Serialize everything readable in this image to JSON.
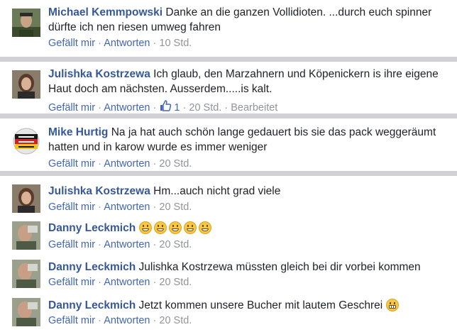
{
  "comments": [
    {
      "author": "Michael Kemmpowski",
      "text": "Danke an die ganzen Vollidioten. ...durch euch spinner dürfte ich nen riesen umweg fahren",
      "like": "Gefällt mir",
      "reply": "Antworten",
      "time": "10 Std."
    },
    {
      "author": "Julishka Kostrzewa",
      "text": "Ich glaub, den Marzahnern und Köpenickern is ihre eigene Haut doch am nächsten. Ausserdem.....is kalt.",
      "like": "Gefällt mir",
      "reply": "Antworten",
      "likes_count": "1",
      "time": "20 Std.",
      "edited": "Bearbeitet"
    },
    {
      "author": "Mike Hurtig",
      "text": "Na ja hat auch schön lange gedauert bis sie das pack weggeräumt hatten und in karow wurde es immer weniger",
      "like": "Gefällt mir",
      "reply": "Antworten",
      "time": "20 Std."
    },
    {
      "author": "Julishka Kostrzewa",
      "text": "Hm...auch nicht grad viele",
      "like": "Gefällt mir",
      "reply": "Antworten",
      "time": "20 Std."
    },
    {
      "author": "Danny Leckmich",
      "text": "",
      "emoji": "laughing-emoji",
      "emoji_count": 5,
      "like": "Gefällt mir",
      "reply": "Antworten",
      "time": "20 Std."
    },
    {
      "author": "Danny Leckmich",
      "text": "Julishka Kostrzewa müssten gleich bei dir vorbei kommen",
      "like": "Gefällt mir",
      "reply": "Antworten",
      "time": "20 Std."
    },
    {
      "author": "Danny Leckmich",
      "text": "Jetzt kommen unsere Bucher mit lautem Geschrei",
      "trailing_emoji": "grimacing-emoji",
      "like": "Gefällt mir",
      "reply": "Antworten",
      "time": "20 Std."
    }
  ],
  "separator": "·",
  "colors": {
    "author": "#365899",
    "link": "#4267b2",
    "meta": "#90949c",
    "divider": "#cfd1d5",
    "text": "#1d2129"
  }
}
